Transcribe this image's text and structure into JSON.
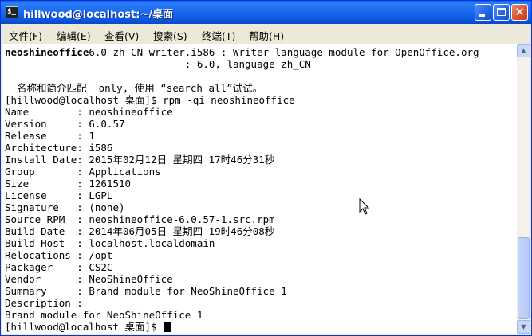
{
  "window": {
    "title": "hillwood@localhost:~/桌面",
    "icon_glyph": "$_",
    "close_glyph": "✕"
  },
  "menu": [
    {
      "label": "文件(F)"
    },
    {
      "label": "编辑(E)"
    },
    {
      "label": "查看(V)"
    },
    {
      "label": "搜索(S)"
    },
    {
      "label": "终端(T)"
    },
    {
      "label": "帮助(H)"
    }
  ],
  "terminal": {
    "line0_bold": "neoshineoffice",
    "line0_rest": "6.0-zh-CN-writer.i586 : Writer language module for OpenOffice.org",
    "lines": [
      "                              : 6.0, language zh_CN",
      "",
      "  名称和简介匹配  only, 使用 “search all”试试。",
      "[hillwood@localhost 桌面]$ rpm -qi neoshineoffice",
      "Name        : neoshineoffice",
      "Version     : 6.0.57",
      "Release     : 1",
      "Architecture: i586",
      "Install Date: 2015年02月12日 星期四 17时46分31秒",
      "Group       : Applications",
      "Size        : 1261510",
      "License     : LGPL",
      "Signature   : (none)",
      "Source RPM  : neoshineoffice-6.0.57-1.src.rpm",
      "Build Date  : 2014年06月05日 星期四 19时46分08秒",
      "Build Host  : localhost.localdomain",
      "Relocations : /opt",
      "Packager    : CS2C",
      "Vendor      : NeoShineOffice",
      "Summary     : Brand module for NeoShineOffice 1",
      "Description :",
      "Brand module for NeoShineOffice 1"
    ],
    "prompt": "[hillwood@localhost 桌面]$ "
  },
  "scrollbar": {
    "up_glyph": "▲",
    "down_glyph": "▼"
  }
}
